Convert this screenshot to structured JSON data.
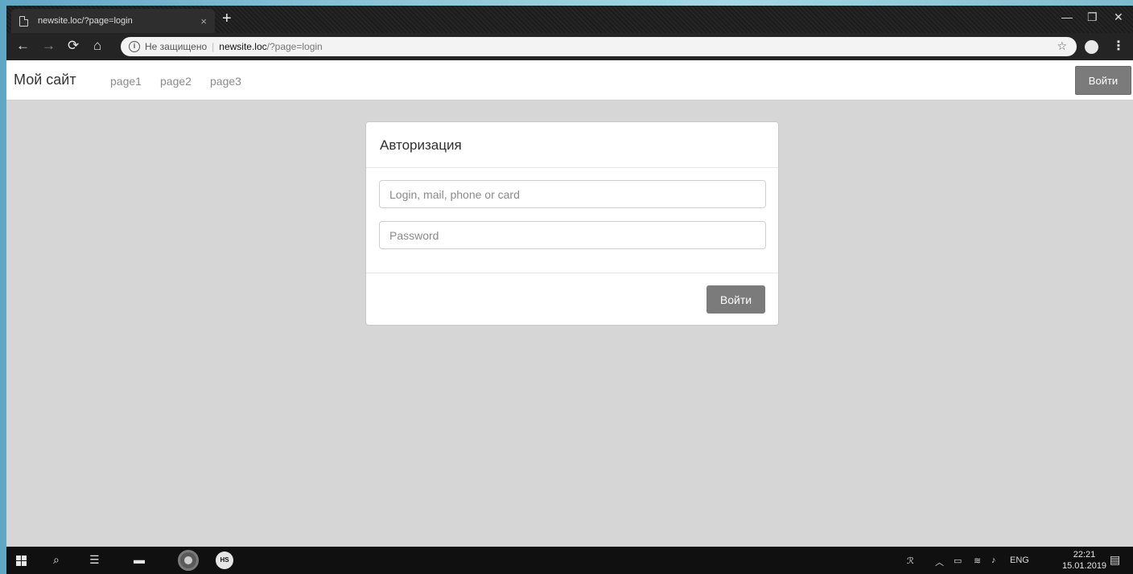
{
  "browser": {
    "tab_title": "newsite.loc/?page=login",
    "tab_close": "×",
    "new_tab": "+",
    "address": {
      "security_label": "Не защищено",
      "separator": "|",
      "host": "newsite.loc",
      "path": "/?page=login"
    }
  },
  "site": {
    "brand": "Мой сайт",
    "nav": [
      {
        "label": "page1"
      },
      {
        "label": "page2"
      },
      {
        "label": "page3"
      }
    ],
    "login_button": "Войти"
  },
  "login_card": {
    "title": "Авторизация",
    "login_placeholder": "Login, mail, phone or card",
    "password_placeholder": "Password",
    "submit_label": "Войти"
  },
  "taskbar": {
    "language": "ENG",
    "time": "22:21",
    "date": "15.01.2019"
  },
  "colors": {
    "button_gray": "#7b7b7b",
    "page_background": "#d6d6d6",
    "chrome_dark": "#242424"
  }
}
